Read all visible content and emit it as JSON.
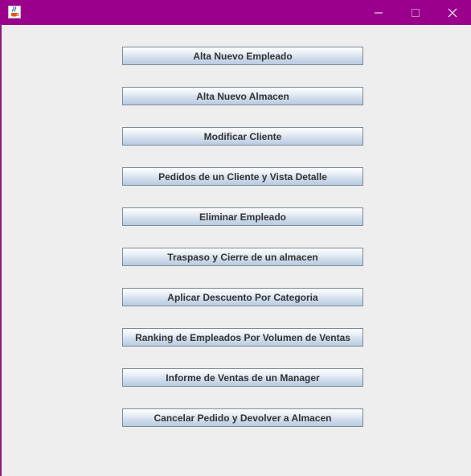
{
  "window": {
    "title": "",
    "titlebar_color": "#9b008c",
    "icon": "java-cup-icon",
    "controls": [
      "minimize-icon",
      "maximize-icon",
      "close-icon"
    ]
  },
  "menu": {
    "buttons": [
      "Alta Nuevo Empleado",
      "Alta Nuevo Almacen",
      "Modificar Cliente",
      "Pedidos de un Cliente y Vista Detalle",
      "Eliminar Empleado",
      "Traspaso y Cierre de un almacen",
      "Aplicar Descuento Por Categoria",
      "Ranking de Empleados Por Volumen de Ventas",
      "Informe de Ventas de un Manager",
      "Cancelar Pedido y Devolver a Almacen"
    ]
  }
}
